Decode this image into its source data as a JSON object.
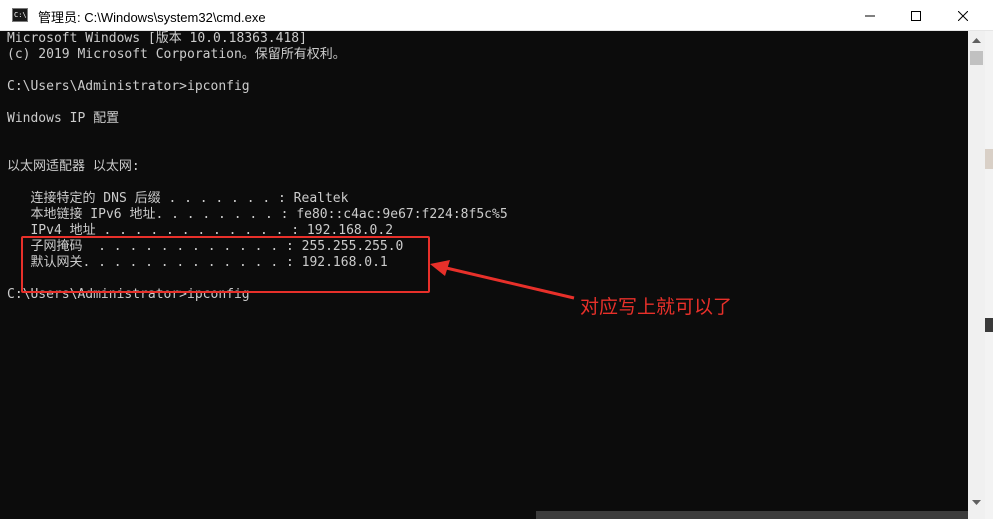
{
  "window": {
    "title": "管理员: C:\\Windows\\system32\\cmd.exe",
    "app_icon_text": "C:\\"
  },
  "console": {
    "lines": [
      "Microsoft Windows [版本 10.0.18363.418]",
      "(c) 2019 Microsoft Corporation。保留所有权利。",
      "",
      "C:\\Users\\Administrator>ipconfig",
      "",
      "Windows IP 配置",
      "",
      "",
      "以太网适配器 以太网:",
      "",
      "   连接特定的 DNS 后缀 . . . . . . . : Realtek",
      "   本地链接 IPv6 地址. . . . . . . . : fe80::c4ac:9e67:f224:8f5c%5",
      "   IPv4 地址 . . . . . . . . . . . . : 192.168.0.2",
      "   子网掩码  . . . . . . . . . . . . : 255.255.255.0",
      "   默认网关. . . . . . . . . . . . . : 192.168.0.1",
      "",
      "C:\\Users\\Administrator>ipconfig"
    ]
  },
  "annotation": {
    "text": "对应写上就可以了",
    "color": "#e8302a"
  },
  "colors": {
    "console_bg": "#0c0c0c",
    "console_fg": "#cccccc",
    "titlebar_bg": "#ffffff"
  },
  "icons": {
    "minimize": "minimize-icon",
    "maximize": "maximize-icon",
    "close": "close-icon"
  }
}
